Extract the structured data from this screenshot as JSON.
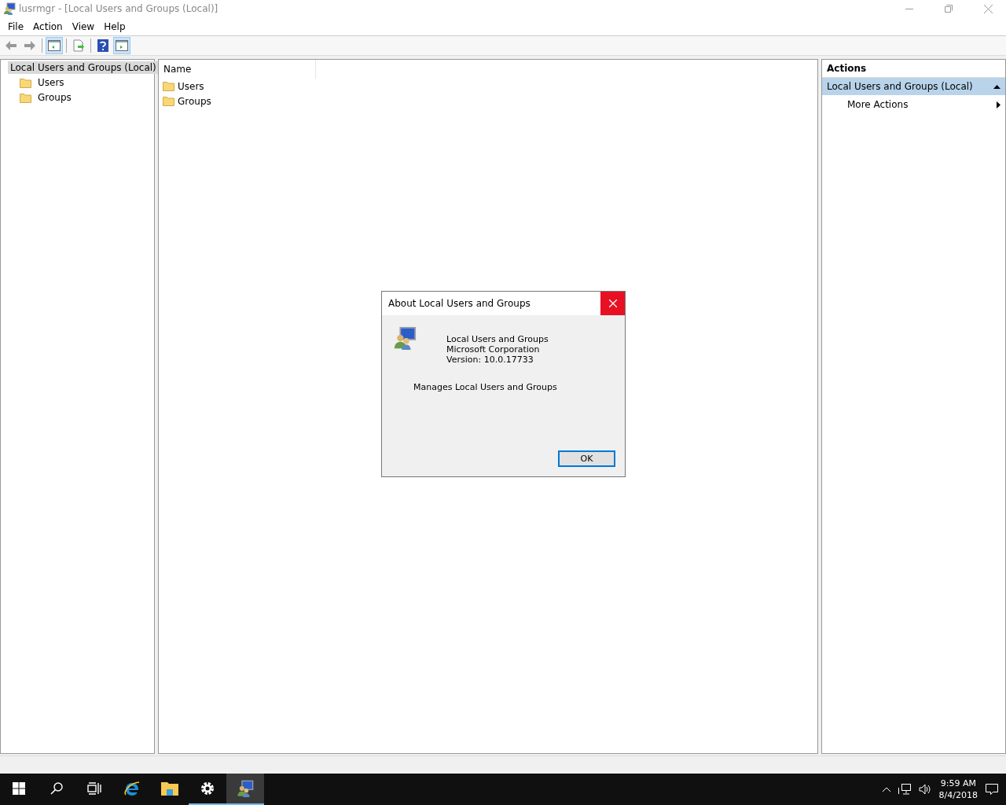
{
  "window": {
    "title": "lusrmgr - [Local Users and Groups (Local)]"
  },
  "menu": [
    "File",
    "Action",
    "View",
    "Help"
  ],
  "toolbar": [
    {
      "kind": "back",
      "pressed": false
    },
    {
      "kind": "forward",
      "pressed": false
    },
    {
      "kind": "tree",
      "pressed": true
    },
    {
      "kind": "export",
      "pressed": false
    },
    {
      "kind": "help",
      "pressed": false
    },
    {
      "kind": "actionpane",
      "pressed": true
    }
  ],
  "tree": {
    "label": "Local Users and Groups (Local)",
    "selected": true,
    "children": [
      {
        "label": "Users",
        "selected": false
      },
      {
        "label": "Groups",
        "selected": false
      }
    ]
  },
  "list": {
    "columns": [
      "Name"
    ],
    "rows": [
      "Users",
      "Groups"
    ]
  },
  "actions": {
    "title": "Actions",
    "sections": [
      {
        "label": "Local Users and Groups (Local)",
        "expanded": true,
        "items": [
          "More Actions"
        ]
      }
    ]
  },
  "dialog": {
    "title": "About Local Users and Groups",
    "info": [
      "Local Users and Groups",
      "Microsoft Corporation",
      "Version: 10.0.17733"
    ],
    "description": "Manages Local Users and Groups",
    "button": "OK"
  },
  "taskbar": {
    "items": [
      {
        "kind": "start",
        "running": false,
        "active": false
      },
      {
        "kind": "search",
        "running": false,
        "active": false
      },
      {
        "kind": "taskview",
        "running": false,
        "active": false
      },
      {
        "kind": "browser",
        "running": false,
        "active": false
      },
      {
        "kind": "folder",
        "running": false,
        "active": false
      },
      {
        "kind": "settings",
        "running": true,
        "active": false
      },
      {
        "kind": "usersapp",
        "running": true,
        "active": true
      }
    ],
    "time": "9:59 AM",
    "date": "8/4/2018"
  }
}
